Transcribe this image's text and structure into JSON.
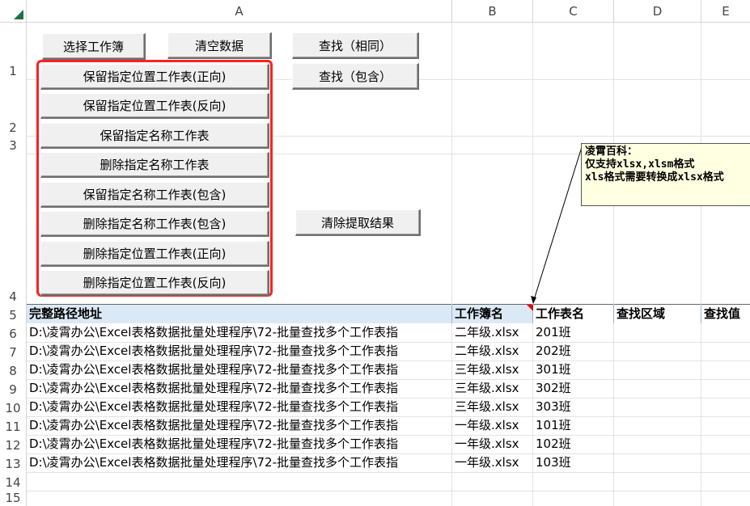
{
  "columns": [
    "A",
    "B",
    "C",
    "D",
    "E"
  ],
  "rows": [
    "1",
    "2",
    "3",
    "4",
    "5",
    "6",
    "7",
    "8",
    "9",
    "10",
    "11",
    "12",
    "13",
    "14",
    "15"
  ],
  "buttons": {
    "select_workbook": "选择工作簿",
    "clear_data": "清空数据",
    "find_same": "查找（相同）",
    "find_contains": "查找（包含）",
    "keep_pos_forward": "保留指定位置工作表(正向)",
    "keep_pos_reverse": "保留指定位置工作表(反向)",
    "keep_name": "保留指定名称工作表",
    "delete_name": "删除指定名称工作表",
    "keep_name_contains": "保留指定名称工作表(包含)",
    "delete_name_contains": "删除指定名称工作表(包含)",
    "delete_pos_forward": "删除指定位置工作表(正向)",
    "delete_pos_reverse": "删除指定位置工作表(反向)",
    "clear_results": "清除提取结果"
  },
  "comment": {
    "line1": "凌霄百科：",
    "line2": "仅支持xlsx,xlsm格式",
    "line3": "xls格式需要转换成xlsx格式"
  },
  "table": {
    "headers": {
      "path": "完整路径地址",
      "workbook": "工作簿名",
      "sheet": "工作表名",
      "area": "查找区域",
      "value": "查找值"
    },
    "rows": [
      {
        "path": "D:\\凌霄办公\\Excel表格数据批量处理程序\\72-批量查找多个工作表指",
        "workbook": "二年级.xlsx",
        "sheet": "201班"
      },
      {
        "path": "D:\\凌霄办公\\Excel表格数据批量处理程序\\72-批量查找多个工作表指",
        "workbook": "二年级.xlsx",
        "sheet": "202班"
      },
      {
        "path": "D:\\凌霄办公\\Excel表格数据批量处理程序\\72-批量查找多个工作表指",
        "workbook": "三年级.xlsx",
        "sheet": "301班"
      },
      {
        "path": "D:\\凌霄办公\\Excel表格数据批量处理程序\\72-批量查找多个工作表指",
        "workbook": "三年级.xlsx",
        "sheet": "302班"
      },
      {
        "path": "D:\\凌霄办公\\Excel表格数据批量处理程序\\72-批量查找多个工作表指",
        "workbook": "三年级.xlsx",
        "sheet": "303班"
      },
      {
        "path": "D:\\凌霄办公\\Excel表格数据批量处理程序\\72-批量查找多个工作表指",
        "workbook": "一年级.xlsx",
        "sheet": "101班"
      },
      {
        "path": "D:\\凌霄办公\\Excel表格数据批量处理程序\\72-批量查找多个工作表指",
        "workbook": "一年级.xlsx",
        "sheet": "102班"
      },
      {
        "path": "D:\\凌霄办公\\Excel表格数据批量处理程序\\72-批量查找多个工作表指",
        "workbook": "一年级.xlsx",
        "sheet": "103班"
      }
    ]
  },
  "colors": {
    "header_fill": "#dbe9f7",
    "highlight_border": "#ff2020",
    "comment_fill": "#ffffe1",
    "select_all_triangle": "#1e7145"
  }
}
